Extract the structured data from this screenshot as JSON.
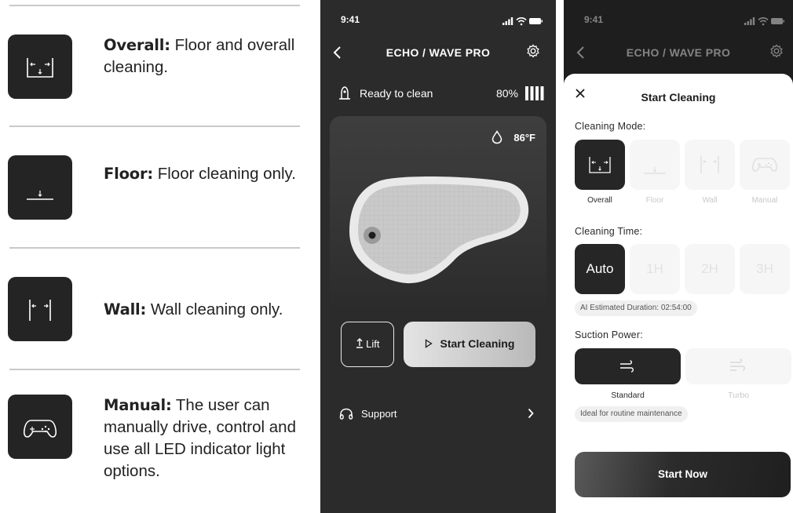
{
  "legend": {
    "items": [
      {
        "name": "Overall:",
        "desc": "Floor and overall cleaning.",
        "icon": "overall-mode-icon"
      },
      {
        "name": "Floor:",
        "desc": "Floor cleaning only.",
        "icon": "floor-mode-icon"
      },
      {
        "name": "Wall:",
        "desc": "Wall cleaning only.",
        "icon": "wall-mode-icon"
      },
      {
        "name": "Manual:",
        "desc": "The user can manually drive, control and use all LED indicator light options.",
        "icon": "gamepad-icon"
      }
    ]
  },
  "phone1": {
    "status_time": "9:41",
    "title": "ECHO / WAVE PRO",
    "status": "Ready to clean",
    "battery": "80%",
    "battery_level": 0.8,
    "temperature": "86°F",
    "lift_label": "Lift",
    "start_label": "Start Cleaning",
    "support_label": "Support"
  },
  "phone2": {
    "status_time": "9:41",
    "title": "ECHO / WAVE PRO",
    "sheet_title": "Start Cleaning",
    "mode_label": "Cleaning Mode:",
    "modes": [
      {
        "label": "Overall",
        "active": true
      },
      {
        "label": "Floor",
        "active": false
      },
      {
        "label": "Wall",
        "active": false
      },
      {
        "label": "Manual",
        "active": false
      }
    ],
    "time_label": "Cleaning Time:",
    "times": [
      {
        "label": "Auto",
        "active": true
      },
      {
        "label": "1H",
        "active": false
      },
      {
        "label": "2H",
        "active": false
      },
      {
        "label": "3H",
        "active": false
      }
    ],
    "estimate": "AI Estimated Duration: 02:54:00",
    "suction_label": "Suction Power:",
    "suction": [
      {
        "label": "Standard",
        "active": true
      },
      {
        "label": "Turbo",
        "active": false
      }
    ],
    "suction_hint": "Ideal for routine maintenance",
    "start_now": "Start Now"
  },
  "colors": {
    "dark_tile": "#262626",
    "phone_bg": "#2b2b2b",
    "light_tile": "#f6f6f6",
    "accent_button": "#c9c9c9"
  }
}
